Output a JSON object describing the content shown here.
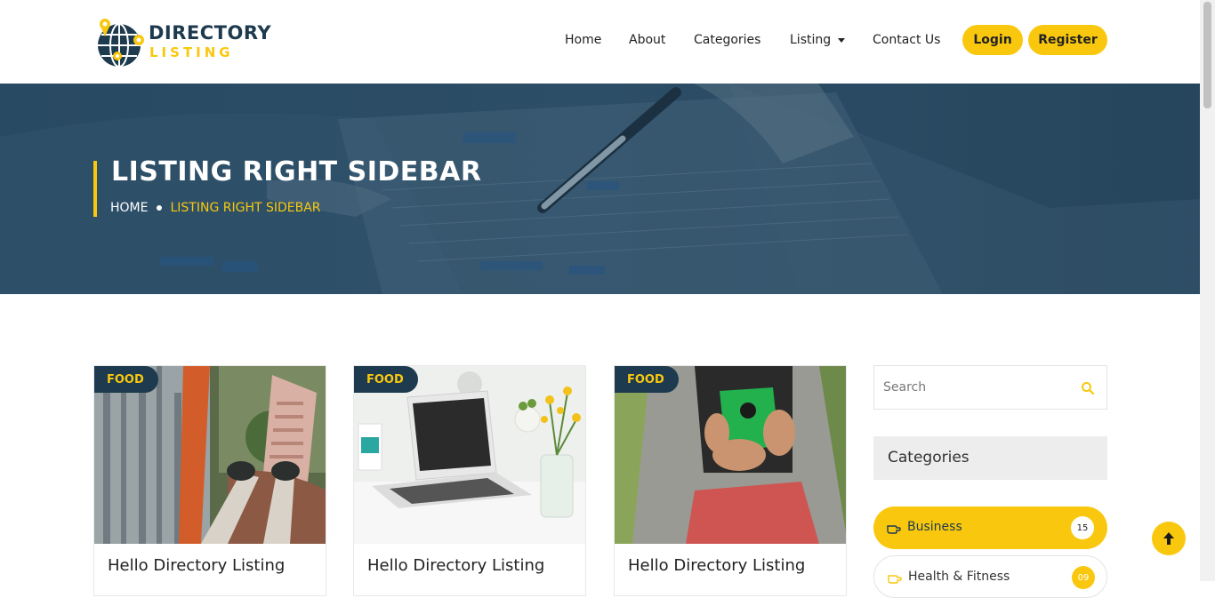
{
  "logo": {
    "line1": "DIRECTORY",
    "line2": "LISTING",
    "icon": "globe-pin-icon"
  },
  "nav": {
    "items": [
      "Home",
      "About",
      "Categories",
      "Listing",
      "Contact Us"
    ],
    "login": "Login",
    "register": "Register"
  },
  "hero": {
    "title": "LISTING RIGHT SIDEBAR",
    "breadcrumb_home": "HOME",
    "breadcrumb_current": "LISTING RIGHT SIDEBAR"
  },
  "listings": [
    {
      "tag": "FOOD",
      "title": "Hello Directory Listing",
      "image": "city-skyscraper-feet-photo"
    },
    {
      "tag": "FOOD",
      "title": "Hello Directory Listing",
      "image": "laptop-desk-flowers-photo"
    },
    {
      "tag": "FOOD",
      "title": "Hello Directory Listing",
      "image": "man-green-phone-photo"
    }
  ],
  "sidebar": {
    "search_placeholder": "Search",
    "search_icon": "search-icon",
    "categories_title": "Categories",
    "categories": [
      {
        "label": "Business",
        "count": "15",
        "active": true
      },
      {
        "label": "Health & Fitness",
        "count": "09",
        "active": false
      }
    ]
  },
  "colors": {
    "accent": "#f9c80e",
    "navy": "#1d3a4e",
    "hero_overlay": "#2a4b62"
  }
}
